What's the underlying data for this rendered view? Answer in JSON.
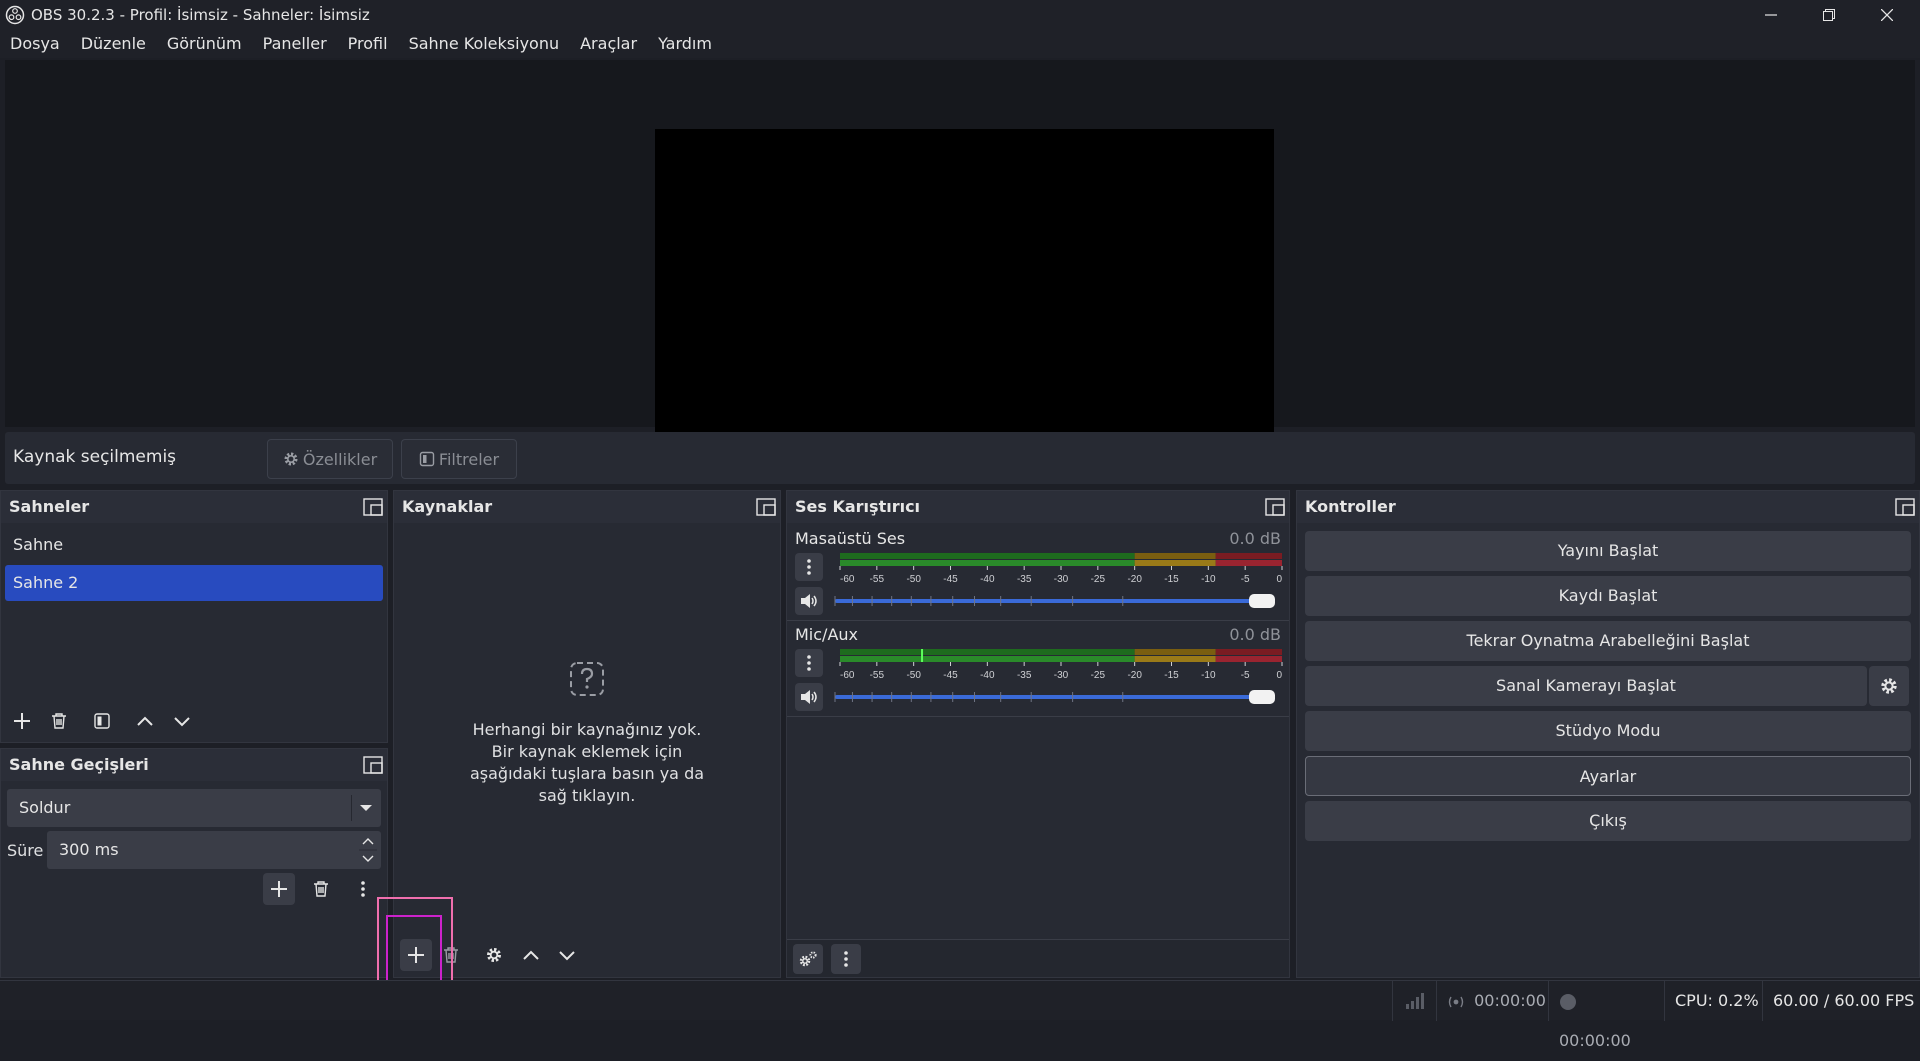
{
  "window": {
    "title": "OBS 30.2.3 - Profil: İsimsiz - Sahneler: İsimsiz"
  },
  "menu": {
    "items": [
      "Dosya",
      "Düzenle",
      "Görünüm",
      "Paneller",
      "Profil",
      "Sahne Koleksiyonu",
      "Araçlar",
      "Yardım"
    ]
  },
  "source_bar": {
    "no_source": "Kaynak seçilmemiş",
    "properties": "Özellikler",
    "filters": "Filtreler"
  },
  "scenes": {
    "title": "Sahneler",
    "items": [
      {
        "label": "Sahne",
        "active": false
      },
      {
        "label": "Sahne 2",
        "active": true
      }
    ]
  },
  "transitions": {
    "title": "Sahne Geçişleri",
    "selected": "Soldur",
    "duration_label": "Süre",
    "duration_value": "300 ms"
  },
  "sources": {
    "title": "Kaynaklar",
    "empty_lines": [
      "Herhangi bir kaynağınız yok.",
      "Bir kaynak eklemek için",
      "aşağıdaki tuşlara basın ya da",
      "sağ tıklayın."
    ]
  },
  "mixer": {
    "title": "Ses Karıştırıcı",
    "scale": [
      "-60",
      "-55",
      "-50",
      "-45",
      "-40",
      "-35",
      "-30",
      "-25",
      "-20",
      "-15",
      "-10",
      "-5",
      "0"
    ],
    "channels": [
      {
        "name": "Masaüstü Ses",
        "db": "0.0 dB",
        "level_db": -60,
        "volume": 1.0
      },
      {
        "name": "Mic/Aux",
        "db": "0.0 dB",
        "level_db": -49,
        "volume": 1.0
      }
    ]
  },
  "controls": {
    "title": "Kontroller",
    "buttons": [
      "Yayını Başlat",
      "Kaydı Başlat",
      "Tekrar Oynatma Arabelleğini Başlat",
      "Sanal Kamerayı Başlat",
      "Stüdyo Modu",
      "Ayarlar",
      "Çıkış"
    ]
  },
  "status": {
    "stream_time": "00:00:00",
    "rec_time": "00:00:00",
    "cpu": "CPU: 0.2%",
    "fps": "60.00 / 60.00 FPS"
  }
}
